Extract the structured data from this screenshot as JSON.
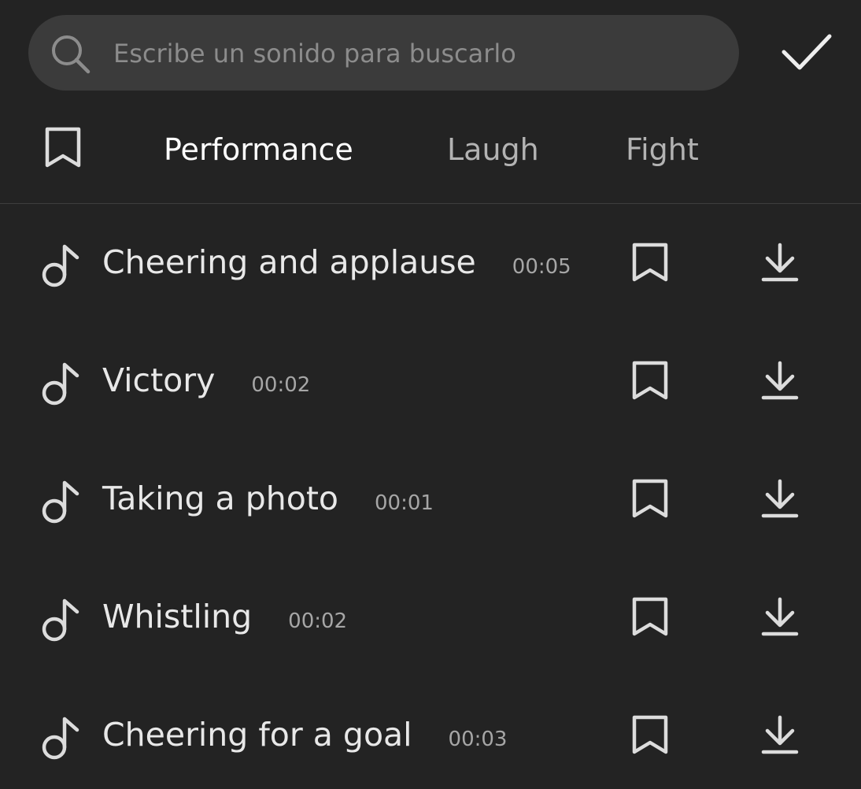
{
  "search": {
    "placeholder": "Escribe un sonido para buscarlo",
    "value": "",
    "icon": "search-icon"
  },
  "confirm": {
    "icon": "checkmark-icon"
  },
  "tabs": {
    "bookmark_icon": "bookmark-icon",
    "items": [
      {
        "label": "Performance",
        "active": true
      },
      {
        "label": "Laugh",
        "active": false
      },
      {
        "label": "Fight",
        "active": false
      }
    ]
  },
  "sounds": [
    {
      "name": "Cheering and applause",
      "duration": "00:05"
    },
    {
      "name": "Victory",
      "duration": "00:02"
    },
    {
      "name": "Taking a photo",
      "duration": "00:01"
    },
    {
      "name": "Whistling",
      "duration": "00:02"
    },
    {
      "name": "Cheering for a goal",
      "duration": "00:03"
    }
  ],
  "colors": {
    "background": "#232323",
    "search_bg": "#3b3b3b",
    "active_tab": "#ffffff",
    "inactive_tab": "#b3b3b3",
    "icon": "#d9d9d9"
  }
}
